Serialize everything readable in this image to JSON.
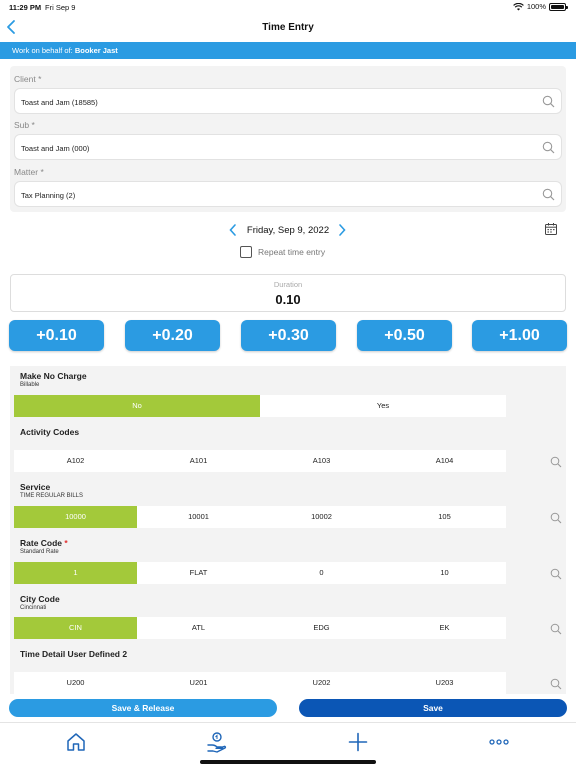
{
  "status": {
    "time": "11:29 PM",
    "date": "Fri Sep 9",
    "battery": "100%"
  },
  "nav": {
    "title": "Time Entry"
  },
  "behalf": {
    "label": "Work on behalf of:",
    "name": "Booker Jast"
  },
  "client": {
    "label": "Client",
    "value": "Toast and Jam (18585)"
  },
  "sub": {
    "label": "Sub",
    "value": "Toast and Jam (000)"
  },
  "matter": {
    "label": "Matter",
    "value": "Tax Planning (2)"
  },
  "required_mark": "*",
  "date": {
    "text": "Friday, Sep 9, 2022"
  },
  "repeat": {
    "label": "Repeat time entry",
    "checked": false
  },
  "duration": {
    "label": "Duration",
    "value": "0.10"
  },
  "increments": [
    "+0.10",
    "+0.20",
    "+0.30",
    "+0.50",
    "+1.00"
  ],
  "sections": {
    "no_charge": {
      "title": "Make No Charge",
      "subtitle": "Billable",
      "options": [
        "No",
        "Yes"
      ],
      "selected": 0
    },
    "activity": {
      "title": "Activity Codes",
      "options": [
        "A102",
        "A101",
        "A103",
        "A104"
      ]
    },
    "service": {
      "title": "Service",
      "subtitle": "TIME REGULAR BILLS",
      "options": [
        "10000",
        "10001",
        "10002",
        "105"
      ],
      "selected": 0
    },
    "rate": {
      "title": "Rate Code",
      "subtitle": "Standard Rate",
      "options": [
        "1",
        "FLAT",
        "0",
        "10"
      ],
      "selected": 0
    },
    "city": {
      "title": "City Code",
      "subtitle": "Cincinnati",
      "options": [
        "CIN",
        "ATL",
        "EDG",
        "EK"
      ],
      "selected": 0
    },
    "user_defined": {
      "title": "Time Detail User Defined 2",
      "options": [
        "U200",
        "U201",
        "U202",
        "U203"
      ]
    }
  },
  "buttons": {
    "save_release": "Save & Release",
    "save": "Save"
  },
  "colors": {
    "accent": "#2b9be2",
    "save": "#0b56b5",
    "selected": "#a3c93a"
  },
  "tabs": [
    "home-icon",
    "hand-coin-icon",
    "plus-icon",
    "more-icon"
  ]
}
